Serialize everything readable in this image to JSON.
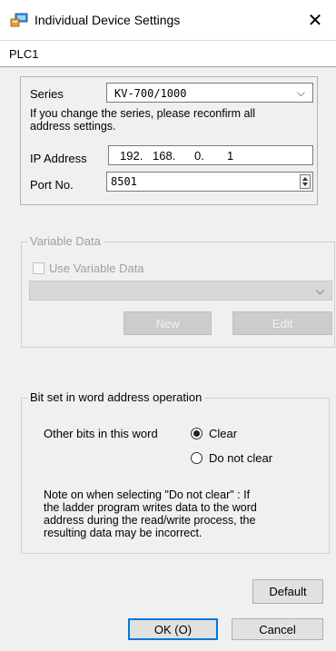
{
  "window": {
    "title": "Individual Device Settings",
    "close": "✕"
  },
  "tab": {
    "label": "PLC1"
  },
  "series": {
    "label": "Series",
    "value": "KV-700/1000",
    "chevron": "⌵"
  },
  "warning": {
    "line1": "If you change the series, please reconfirm all",
    "line2": "address settings."
  },
  "ip": {
    "label": "IP Address",
    "seg1": "192.",
    "seg2": "168.",
    "seg3": "0.",
    "seg4": "1"
  },
  "port": {
    "label": "Port No.",
    "value": "8501"
  },
  "variable": {
    "group_title": "Variable Data",
    "checkbox_label": "Use Variable Data",
    "chevron": "⌵",
    "new_label": "New",
    "edit_label": "Edit"
  },
  "bitset": {
    "group_title": "Bit set in word address operation",
    "other_bits_label": "Other bits in this word",
    "option_clear": "Clear",
    "option_do_not_clear": "Do not clear",
    "selected": "Clear",
    "note_lines": [
      "Note on when selecting \"Do not clear\" : If",
      "the ladder program writes data to the word",
      "address during the read/write process, the",
      "resulting data may be incorrect."
    ]
  },
  "buttons": {
    "default": "Default",
    "ok": "OK (O)",
    "cancel": "Cancel"
  },
  "colors": {
    "accent": "#0078d7",
    "window_bg": "#f0f0f0",
    "disabled_text": "#a0a0a0"
  }
}
